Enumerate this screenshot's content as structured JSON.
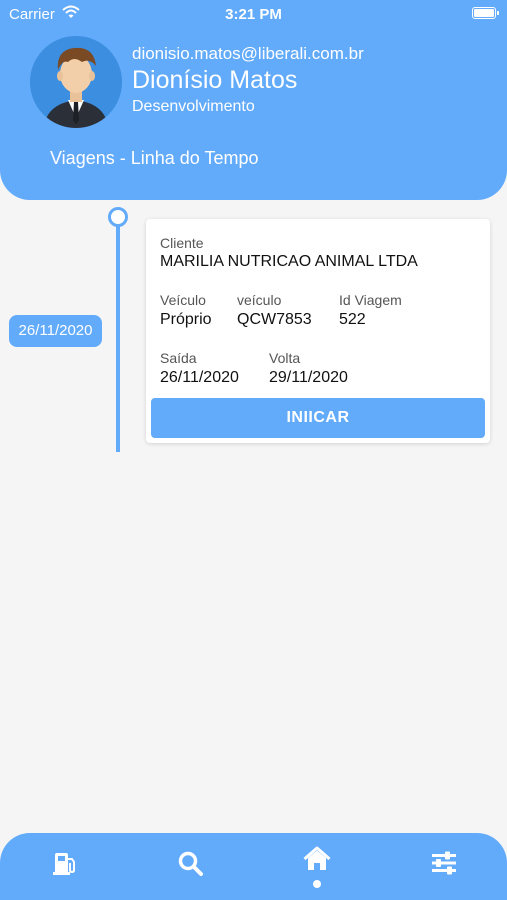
{
  "status_bar": {
    "carrier": "Carrier",
    "time": "3:21 PM"
  },
  "profile": {
    "email": "dionisio.matos@liberali.com.br",
    "name": "Dionísio Matos",
    "department": "Desenvolvimento"
  },
  "page": {
    "title": "Viagens - Linha do Tempo"
  },
  "timeline": [
    {
      "date": "26/11/2020",
      "client_label": "Cliente",
      "client": "MARILIA NUTRICAO ANIMAL LTDA",
      "vehicle_label": "Veículo",
      "vehicle": "Próprio",
      "plate_label": "veículo",
      "plate": "QCW7853",
      "trip_id_label": "Id Viagem",
      "trip_id": "522",
      "departure_label": "Saída",
      "departure": "26/11/2020",
      "return_label": "Volta",
      "return": "29/11/2020",
      "action_label": "INIICAR"
    }
  ],
  "tabbar": {
    "tabs": [
      {
        "icon": "fuel-pump-icon",
        "active": false
      },
      {
        "icon": "search-icon",
        "active": false
      },
      {
        "icon": "home-icon",
        "active": true
      },
      {
        "icon": "sliders-icon",
        "active": false
      }
    ]
  },
  "colors": {
    "primary": "#62aafa",
    "background": "#f5f5f5",
    "card": "#ffffff"
  }
}
